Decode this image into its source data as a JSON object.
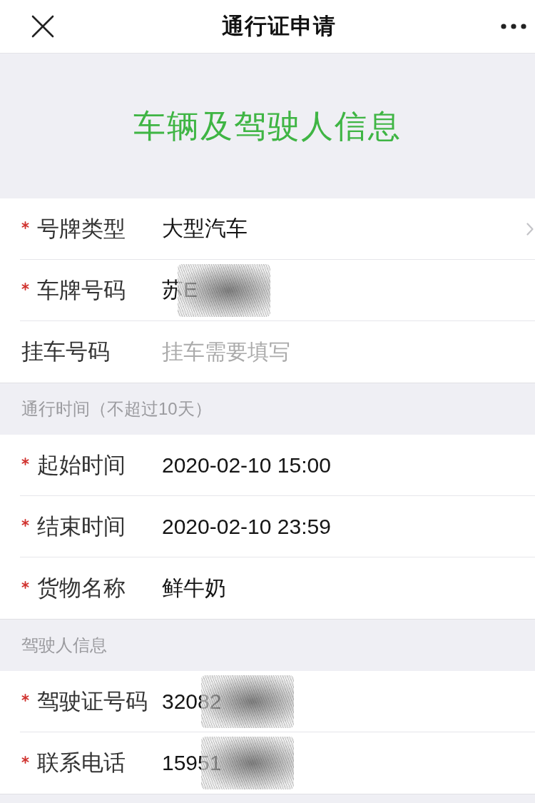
{
  "nav": {
    "title": "通行证申请"
  },
  "banner": {
    "title": "车辆及驾驶人信息"
  },
  "sections": [
    {
      "fields": [
        {
          "kind": "select",
          "label": "号牌类型",
          "required": true,
          "value": "大型汽车",
          "redacted": false
        },
        {
          "kind": "text",
          "label": "车牌号码",
          "required": true,
          "value": "苏E",
          "redacted": true
        },
        {
          "kind": "text",
          "label": "挂车号码",
          "required": false,
          "placeholder": "挂车需要填写",
          "redacted": false
        }
      ]
    },
    {
      "header": "通行时间（不超过10天）",
      "fields": [
        {
          "kind": "text",
          "label": "起始时间",
          "required": true,
          "value": "2020-02-10 15:00",
          "redacted": false
        },
        {
          "kind": "text",
          "label": "结束时间",
          "required": true,
          "value": "2020-02-10 23:59",
          "redacted": false
        },
        {
          "kind": "text",
          "label": "货物名称",
          "required": true,
          "value": "鲜牛奶",
          "redacted": false
        }
      ]
    },
    {
      "header": "驾驶人信息",
      "fields": [
        {
          "kind": "text",
          "label": "驾驶证号码",
          "required": true,
          "value": "32082",
          "redacted": true
        },
        {
          "kind": "text",
          "label": "联系电话",
          "required": true,
          "value": "15951",
          "redacted": true
        }
      ]
    }
  ]
}
